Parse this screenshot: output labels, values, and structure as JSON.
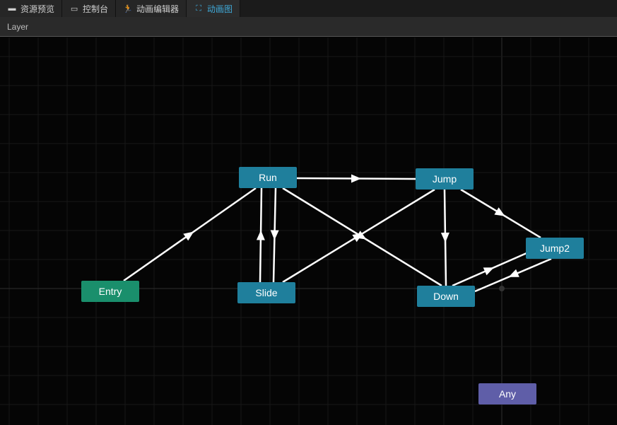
{
  "tabs": [
    {
      "label": "资源预览",
      "icon": "folder-icon"
    },
    {
      "label": "控制台",
      "icon": "terminal-icon"
    },
    {
      "label": "动画编辑器",
      "icon": "running-man-icon"
    },
    {
      "label": "动画图",
      "icon": "graph-icon",
      "active": true
    }
  ],
  "layer_label": "Layer",
  "colors": {
    "state": "#1f7f9c",
    "entry": "#1a8f6c",
    "any": "#5f5ea8"
  },
  "nodes": {
    "run": "Run",
    "jump": "Jump",
    "jump2": "Jump2",
    "entry": "Entry",
    "slide": "Slide",
    "down": "Down",
    "any": "Any"
  },
  "transitions": [
    {
      "from": "Entry",
      "to": "Run"
    },
    {
      "from": "Run",
      "to": "Jump"
    },
    {
      "from": "Run",
      "to": "Slide"
    },
    {
      "from": "Slide",
      "to": "Run"
    },
    {
      "from": "Run",
      "to": "Down"
    },
    {
      "from": "Slide",
      "to": "Jump"
    },
    {
      "from": "Jump",
      "to": "Down"
    },
    {
      "from": "Jump",
      "to": "Jump2"
    },
    {
      "from": "Down",
      "to": "Jump2"
    },
    {
      "from": "Jump2",
      "to": "Down"
    }
  ]
}
